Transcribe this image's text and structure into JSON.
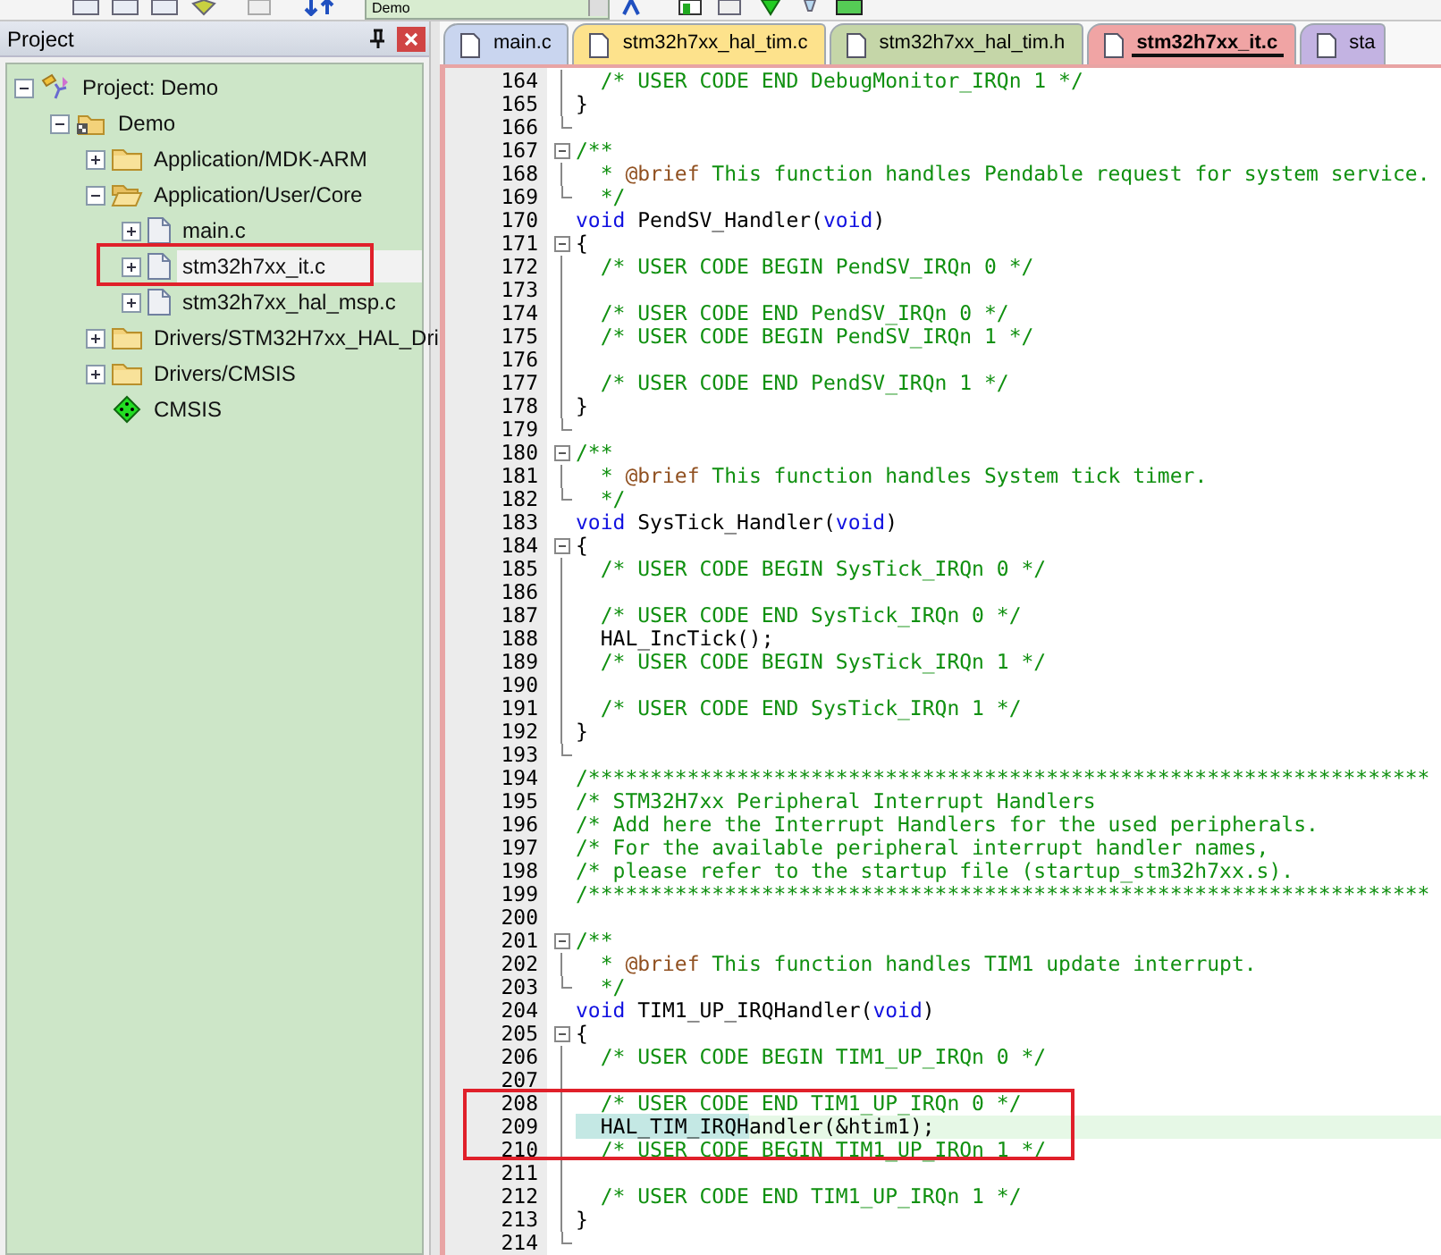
{
  "toolbar": {
    "target": "Demo"
  },
  "project_panel": {
    "title": "Project"
  },
  "tree": [
    {
      "label": "Project: Demo",
      "kind": "project",
      "expanded": true,
      "selected": false,
      "boxed": false,
      "children": [
        {
          "label": "Demo",
          "kind": "target",
          "expanded": true,
          "selected": false,
          "boxed": false,
          "children": [
            {
              "label": "Application/MDK-ARM",
              "kind": "folder",
              "expanded": false,
              "selected": false,
              "boxed": false
            },
            {
              "label": "Application/User/Core",
              "kind": "folder",
              "expanded": true,
              "selected": false,
              "boxed": false,
              "children": [
                {
                  "label": "main.c",
                  "kind": "file",
                  "expanded": false,
                  "selected": false,
                  "boxed": false
                },
                {
                  "label": "stm32h7xx_it.c",
                  "kind": "file",
                  "expanded": false,
                  "selected": true,
                  "boxed": true
                },
                {
                  "label": "stm32h7xx_hal_msp.c",
                  "kind": "file",
                  "expanded": false,
                  "selected": false,
                  "boxed": false
                }
              ]
            },
            {
              "label": "Drivers/STM32H7xx_HAL_Dri",
              "kind": "folder",
              "expanded": false,
              "selected": false,
              "boxed": false
            },
            {
              "label": "Drivers/CMSIS",
              "kind": "folder",
              "expanded": false,
              "selected": false,
              "boxed": false
            },
            {
              "label": "CMSIS",
              "kind": "component",
              "selected": false,
              "boxed": false
            }
          ]
        }
      ]
    }
  ],
  "tabs": [
    {
      "label": "main.c",
      "color": "#c9d5ef",
      "selected": false
    },
    {
      "label": "stm32h7xx_hal_tim.c",
      "color": "#fde28c",
      "selected": false
    },
    {
      "label": "stm32h7xx_hal_tim.h",
      "color": "#c5d6a8",
      "selected": false
    },
    {
      "label": "stm32h7xx_it.c",
      "color": "#f0a4a4",
      "selected": true
    },
    {
      "label": "sta",
      "color": "#c3b3e2",
      "selected": false
    }
  ],
  "code": {
    "lines": [
      {
        "num": "164",
        "kind": "fold-line",
        "tokens": [
          {
            "kind": "comment",
            "text": "  /* USER CODE END DebugMonitor_IRQn 1 */"
          }
        ]
      },
      {
        "num": "165",
        "kind": "fold-line",
        "tokens": [
          {
            "kind": "plain",
            "text": "}"
          }
        ]
      },
      {
        "num": "166",
        "kind": "fold-end"
      },
      {
        "num": "167",
        "kind": "fold-start",
        "tokens": [
          {
            "kind": "comment",
            "text": "/**"
          }
        ]
      },
      {
        "num": "168",
        "kind": "fold-line",
        "tokens": [
          {
            "kind": "comment",
            "text": "  * "
          },
          {
            "kind": "doc-tag",
            "text": "@brief"
          },
          {
            "kind": "comment",
            "text": " This function handles Pendable request for system service."
          }
        ]
      },
      {
        "num": "169",
        "kind": "fold-end",
        "tokens": [
          {
            "kind": "comment",
            "text": "  */"
          }
        ]
      },
      {
        "num": "170",
        "kind": "plain",
        "tokens": [
          {
            "kind": "keyword",
            "text": "void"
          },
          {
            "kind": "plain",
            "text": " PendSV_Handler("
          },
          {
            "kind": "keyword",
            "text": "void"
          },
          {
            "kind": "plain",
            "text": ")"
          }
        ]
      },
      {
        "num": "171",
        "kind": "fold-start",
        "tokens": [
          {
            "kind": "plain",
            "text": "{"
          }
        ]
      },
      {
        "num": "172",
        "kind": "fold-line",
        "tokens": [
          {
            "kind": "comment",
            "text": "  /* USER CODE BEGIN PendSV_IRQn 0 */"
          }
        ]
      },
      {
        "num": "173",
        "kind": "fold-line"
      },
      {
        "num": "174",
        "kind": "fold-line",
        "tokens": [
          {
            "kind": "comment",
            "text": "  /* USER CODE END PendSV_IRQn 0 */"
          }
        ]
      },
      {
        "num": "175",
        "kind": "fold-line",
        "tokens": [
          {
            "kind": "comment",
            "text": "  /* USER CODE BEGIN PendSV_IRQn 1 */"
          }
        ]
      },
      {
        "num": "176",
        "kind": "fold-line"
      },
      {
        "num": "177",
        "kind": "fold-line",
        "tokens": [
          {
            "kind": "comment",
            "text": "  /* USER CODE END PendSV_IRQn 1 */"
          }
        ]
      },
      {
        "num": "178",
        "kind": "fold-line",
        "tokens": [
          {
            "kind": "plain",
            "text": "}"
          }
        ]
      },
      {
        "num": "179",
        "kind": "fold-end"
      },
      {
        "num": "180",
        "kind": "fold-start",
        "tokens": [
          {
            "kind": "comment",
            "text": "/**"
          }
        ]
      },
      {
        "num": "181",
        "kind": "fold-line",
        "tokens": [
          {
            "kind": "comment",
            "text": "  * "
          },
          {
            "kind": "doc-tag",
            "text": "@brief"
          },
          {
            "kind": "comment",
            "text": " This function handles System tick timer."
          }
        ]
      },
      {
        "num": "182",
        "kind": "fold-end",
        "tokens": [
          {
            "kind": "comment",
            "text": "  */"
          }
        ]
      },
      {
        "num": "183",
        "kind": "plain",
        "tokens": [
          {
            "kind": "keyword",
            "text": "void"
          },
          {
            "kind": "plain",
            "text": " SysTick_Handler("
          },
          {
            "kind": "keyword",
            "text": "void"
          },
          {
            "kind": "plain",
            "text": ")"
          }
        ]
      },
      {
        "num": "184",
        "kind": "fold-start",
        "tokens": [
          {
            "kind": "plain",
            "text": "{"
          }
        ]
      },
      {
        "num": "185",
        "kind": "fold-line",
        "tokens": [
          {
            "kind": "comment",
            "text": "  /* USER CODE BEGIN SysTick_IRQn 0 */"
          }
        ]
      },
      {
        "num": "186",
        "kind": "fold-line"
      },
      {
        "num": "187",
        "kind": "fold-line",
        "tokens": [
          {
            "kind": "comment",
            "text": "  /* USER CODE END SysTick_IRQn 0 */"
          }
        ]
      },
      {
        "num": "188",
        "kind": "fold-line",
        "tokens": [
          {
            "kind": "plain",
            "text": "  HAL_IncTick();"
          }
        ]
      },
      {
        "num": "189",
        "kind": "fold-line",
        "tokens": [
          {
            "kind": "comment",
            "text": "  /* USER CODE BEGIN SysTick_IRQn 1 */"
          }
        ]
      },
      {
        "num": "190",
        "kind": "fold-line"
      },
      {
        "num": "191",
        "kind": "fold-line",
        "tokens": [
          {
            "kind": "comment",
            "text": "  /* USER CODE END SysTick_IRQn 1 */"
          }
        ]
      },
      {
        "num": "192",
        "kind": "fold-line",
        "tokens": [
          {
            "kind": "plain",
            "text": "}"
          }
        ]
      },
      {
        "num": "193",
        "kind": "fold-end"
      },
      {
        "num": "194",
        "kind": "plain",
        "tokens": [
          {
            "kind": "comment",
            "text": "/********************************************************************"
          }
        ]
      },
      {
        "num": "195",
        "kind": "plain",
        "tokens": [
          {
            "kind": "comment",
            "text": "/* STM32H7xx Peripheral Interrupt Handlers"
          }
        ]
      },
      {
        "num": "196",
        "kind": "plain",
        "tokens": [
          {
            "kind": "comment",
            "text": "/* Add here the Interrupt Handlers for the used peripherals."
          }
        ]
      },
      {
        "num": "197",
        "kind": "plain",
        "tokens": [
          {
            "kind": "comment",
            "text": "/* For the available peripheral interrupt handler names,"
          }
        ]
      },
      {
        "num": "198",
        "kind": "plain",
        "tokens": [
          {
            "kind": "comment",
            "text": "/* please refer to the startup file (startup_stm32h7xx.s)."
          }
        ]
      },
      {
        "num": "199",
        "kind": "plain",
        "tokens": [
          {
            "kind": "comment",
            "text": "/********************************************************************"
          }
        ]
      },
      {
        "num": "200",
        "kind": "plain"
      },
      {
        "num": "201",
        "kind": "fold-start",
        "tokens": [
          {
            "kind": "comment",
            "text": "/**"
          }
        ]
      },
      {
        "num": "202",
        "kind": "fold-line",
        "tokens": [
          {
            "kind": "comment",
            "text": "  * "
          },
          {
            "kind": "doc-tag",
            "text": "@brief"
          },
          {
            "kind": "comment",
            "text": " This function handles TIM1 update interrupt."
          }
        ]
      },
      {
        "num": "203",
        "kind": "fold-end",
        "tokens": [
          {
            "kind": "comment",
            "text": "  */"
          }
        ]
      },
      {
        "num": "204",
        "kind": "plain",
        "tokens": [
          {
            "kind": "keyword",
            "text": "void"
          },
          {
            "kind": "plain",
            "text": " TIM1_UP_IRQHandler("
          },
          {
            "kind": "keyword",
            "text": "void"
          },
          {
            "kind": "plain",
            "text": ")"
          }
        ]
      },
      {
        "num": "205",
        "kind": "fold-start",
        "tokens": [
          {
            "kind": "plain",
            "text": "{"
          }
        ]
      },
      {
        "num": "206",
        "kind": "fold-line",
        "tokens": [
          {
            "kind": "comment",
            "text": "  /* USER CODE BEGIN TIM1_UP_IRQn 0 */"
          }
        ]
      },
      {
        "num": "207",
        "kind": "fold-line"
      },
      {
        "num": "208",
        "kind": "fold-line",
        "boxed": true,
        "tokens": [
          {
            "kind": "comment",
            "text": "  /* USER CODE END TIM1_UP_IRQn 0 */"
          }
        ]
      },
      {
        "num": "209",
        "kind": "fold-line",
        "boxed": true,
        "current": true,
        "tokens": [
          {
            "kind": "match",
            "text": "  HAL_TIM_IRQH"
          },
          {
            "kind": "plain",
            "text": "andler(&htim1);"
          }
        ]
      },
      {
        "num": "210",
        "kind": "fold-line",
        "boxed": true,
        "tokens": [
          {
            "kind": "comment",
            "text": "  /* USER CODE BEGIN TIM1_UP_IRQn 1 */"
          }
        ]
      },
      {
        "num": "211",
        "kind": "fold-line"
      },
      {
        "num": "212",
        "kind": "fold-line",
        "tokens": [
          {
            "kind": "comment",
            "text": "  /* USER CODE END TIM1_UP_IRQn 1 */"
          }
        ]
      },
      {
        "num": "213",
        "kind": "fold-line",
        "tokens": [
          {
            "kind": "plain",
            "text": "}"
          }
        ]
      },
      {
        "num": "214",
        "kind": "fold-end"
      }
    ]
  }
}
